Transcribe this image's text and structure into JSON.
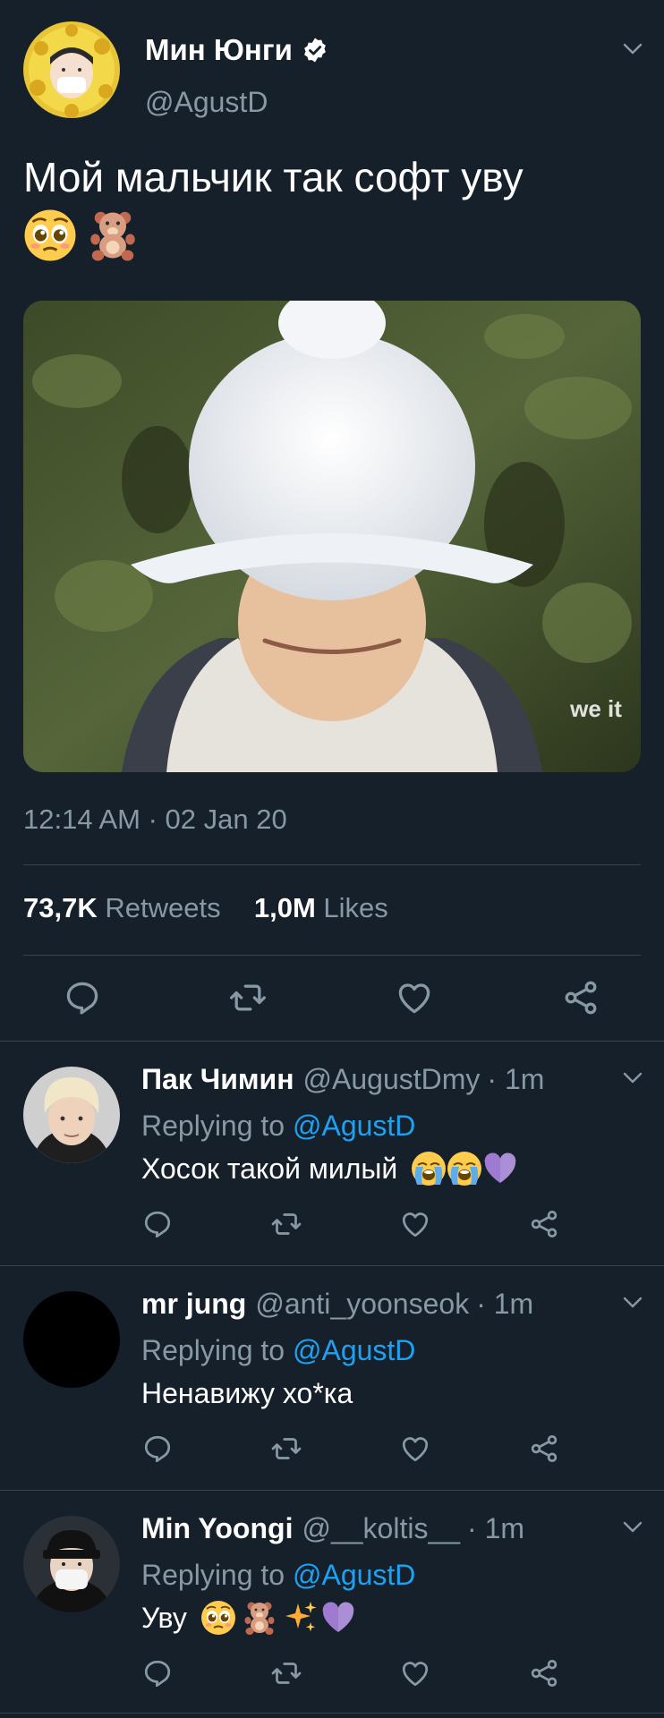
{
  "colors": {
    "background": "#15202b",
    "text": "#ffffff",
    "secondary": "#8899a6",
    "link": "#1da1f2",
    "divider": "#38444d"
  },
  "main_tweet": {
    "display_name": "Мин Юнги",
    "verified": true,
    "handle": "@AgustD",
    "text": "Мой мальчик так софт уву",
    "emojis": [
      "pleading-face-emoji",
      "teddy-bear-emoji"
    ],
    "media_watermark": "we it",
    "timestamp": "12:14 AM · 02 Jan 20",
    "retweets_count": "73,7K",
    "retweets_label": "Retweets",
    "likes_count": "1,0M",
    "likes_label": "Likes"
  },
  "replies": [
    {
      "display_name": "Пак Чимин",
      "handle": "@AugustDmy",
      "time": "· 1m",
      "replying_prefix": "Replying to",
      "replying_to": "@AgustD",
      "text": "Хосок такой милый",
      "emojis": [
        "loudly-crying-face-emoji",
        "loudly-crying-face-emoji",
        "purple-heart-emoji"
      ]
    },
    {
      "display_name": "mr jung",
      "handle": "@anti_yoonseok",
      "time": "· 1m",
      "replying_prefix": "Replying to",
      "replying_to": "@AgustD",
      "text": "Ненавижу хо*ка",
      "emojis": []
    },
    {
      "display_name": "Min Yoongi",
      "handle": "@__koltis__",
      "time": "· 1m",
      "replying_prefix": "Replying to",
      "replying_to": "@AgustD",
      "text": "Уву",
      "emojis": [
        "pleading-face-emoji",
        "teddy-bear-emoji",
        "sparkles-emoji",
        "purple-heart-emoji"
      ]
    }
  ],
  "icons": [
    "reply-icon",
    "retweet-icon",
    "like-icon",
    "share-icon",
    "chevron-down-icon",
    "verified-badge-icon"
  ]
}
